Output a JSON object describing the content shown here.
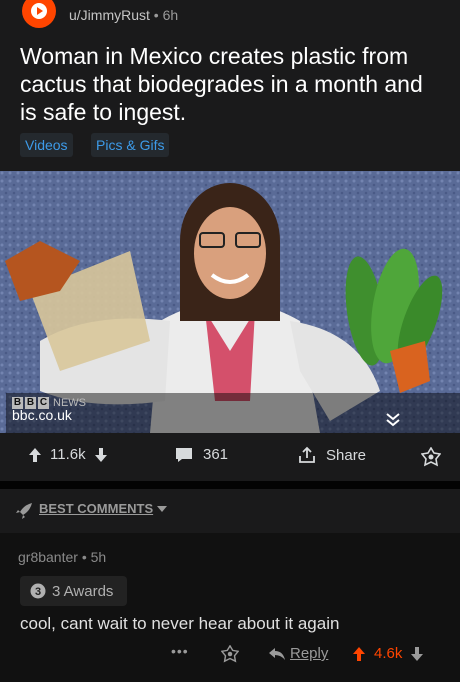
{
  "post": {
    "username": "u/JimmyRust",
    "separator": "•",
    "age": "6h",
    "title": "Woman in Mexico creates plastic from cactus that biodegrades in a month and is safe to ingest.",
    "flairs": [
      "Videos",
      "Pics & Gifs"
    ]
  },
  "media": {
    "source_name": "NEWS",
    "source_url": "bbc.co.uk"
  },
  "actions": {
    "score": "11.6k",
    "comments": "361",
    "share_label": "Share"
  },
  "sort": {
    "label": "BEST COMMENTS"
  },
  "comment": {
    "author": "gr8banter",
    "separator": "•",
    "age": "5h",
    "awards": "3 Awards",
    "awards_icon_text": "3",
    "body": "cool, cant wait to never hear about it again",
    "more": "•••",
    "reply_label": "Reply",
    "score": "4.6k"
  },
  "colors": {
    "background": "#1a1a1b",
    "accent": "#ff4500",
    "flair_text": "#3d9be9"
  }
}
